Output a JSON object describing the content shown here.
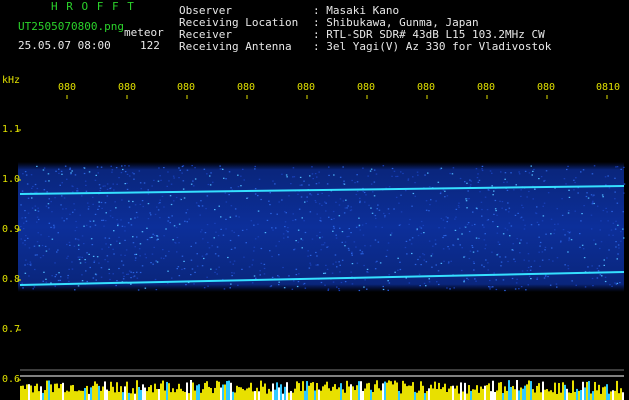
{
  "header": {
    "logo": "H R O F F T",
    "filename": "UT2505070800.png",
    "datetime": "25.05.07 08:00",
    "meteor_label": "meteor",
    "meteor_count": "122"
  },
  "info": {
    "labels": [
      "Observer",
      "Receiving Location",
      "Receiver",
      "Receiving Antenna"
    ],
    "values": [
      ": Masaki Kano",
      ": Shibukawa, Gunma, Japan",
      ": RTL-SDR SDR# 43dB L15 103.2MHz CW",
      ": 3el Yagi(V) Az 330 for Vladivostok"
    ]
  },
  "axis": {
    "unit": "kHz",
    "y_ticks": [
      "1.1",
      "1.0",
      "0.9",
      "0.8",
      "0.7",
      "0.6"
    ],
    "x_ticks": [
      "080",
      "080",
      "080",
      "080",
      "080",
      "080",
      "080",
      "080",
      "080",
      "0810"
    ]
  },
  "colors": {
    "text_header": "#2bd22b",
    "text_info": "#e8e8e8",
    "ticks": "#f0f000",
    "noise": "#1030a0",
    "signal": "#30d8ff"
  }
}
